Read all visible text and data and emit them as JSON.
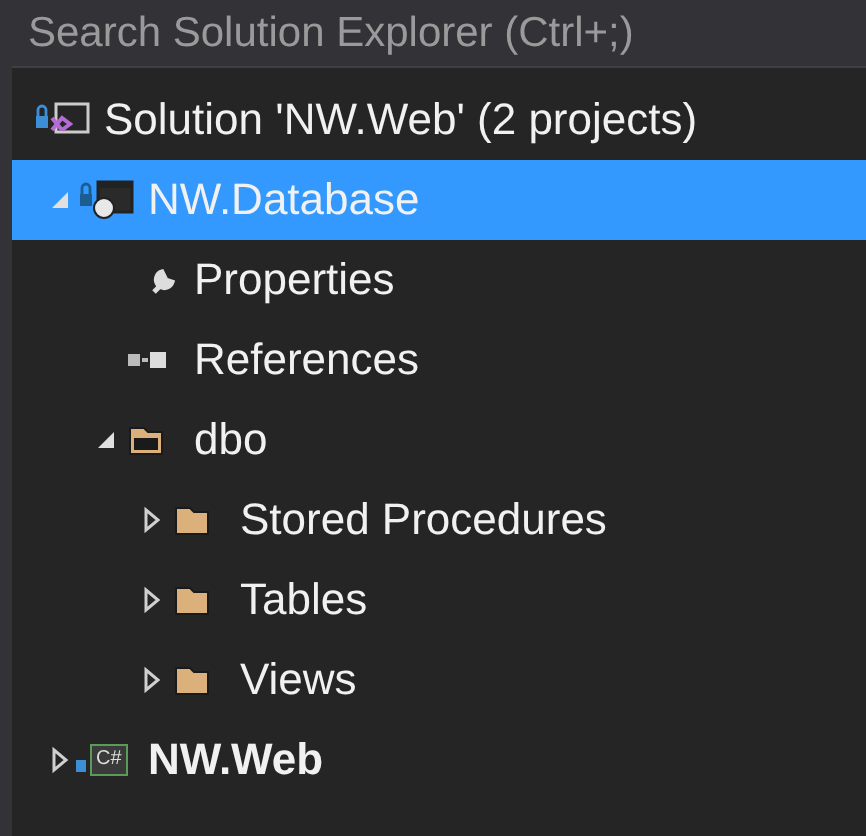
{
  "search": {
    "placeholder": "Search Solution Explorer (Ctrl+;)"
  },
  "tree": [
    {
      "label": "Solution 'NW.Web' (2 projects)",
      "kind": "solution",
      "selected": false,
      "bold": false,
      "children": [
        {
          "label": "NW.Database",
          "kind": "db-project",
          "selected": true,
          "bold": false,
          "expanded": true,
          "children": [
            {
              "label": "Properties",
              "kind": "properties",
              "selected": false,
              "bold": false
            },
            {
              "label": "References",
              "kind": "references",
              "selected": false,
              "bold": false
            },
            {
              "label": "dbo",
              "kind": "folder",
              "selected": false,
              "bold": false,
              "expanded": true,
              "children": [
                {
                  "label": "Stored Procedures",
                  "kind": "folder",
                  "selected": false,
                  "bold": false,
                  "expanded": false
                },
                {
                  "label": "Tables",
                  "kind": "folder",
                  "selected": false,
                  "bold": false,
                  "expanded": false
                },
                {
                  "label": "Views",
                  "kind": "folder",
                  "selected": false,
                  "bold": false,
                  "expanded": false
                }
              ]
            }
          ]
        },
        {
          "label": "NW.Web",
          "kind": "cs-project",
          "badge": "C#",
          "selected": false,
          "bold": true,
          "expanded": false
        }
      ]
    }
  ]
}
